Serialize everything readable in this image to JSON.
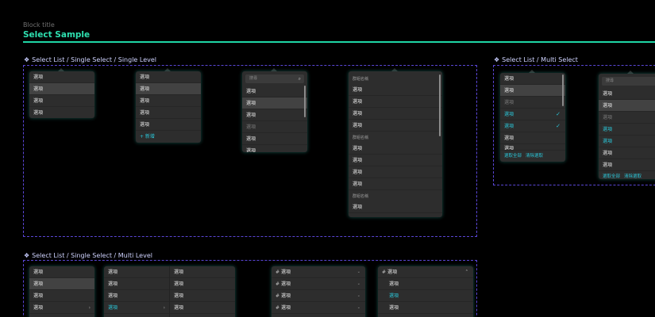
{
  "block": {
    "label": "Block title",
    "title": "Select Sample"
  },
  "sections": {
    "single_level": "Select List / Single Select / Single Level",
    "multi_select": "Select List / Multi Select",
    "multi_level": "Select List / Single Select / Multi Level"
  },
  "option_label": "選項",
  "group_label": "群組名稱",
  "add_label": "+ 新增",
  "search_placeholder": "搜尋",
  "select_all_label": "選取全部",
  "clear_label": "清除選取",
  "icons": {
    "search": "magnifier-icon",
    "check": "check-icon",
    "chevron_right": "chevron-right-icon",
    "chevron_down": "chevron-down-icon",
    "chevron_up": "chevron-up-icon",
    "hash": "hash-icon",
    "diamond": "diamond-icon"
  },
  "colors": {
    "accent": "#2bc4d6",
    "title": "#2ee0b0",
    "frame": "#5a46d6",
    "panel": "#2d2d2d"
  }
}
